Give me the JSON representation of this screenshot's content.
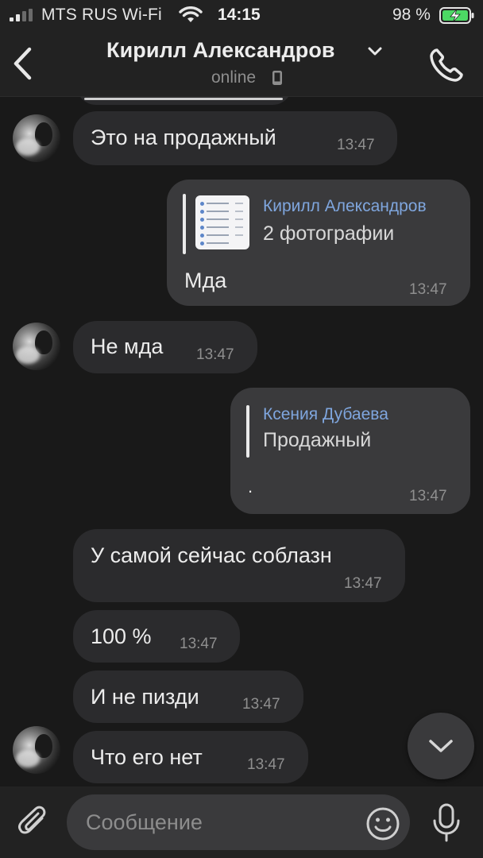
{
  "status_bar": {
    "carrier": "MTS RUS Wi-Fi",
    "time": "14:15",
    "battery_percent": "98 %",
    "icons": [
      "signal-icon",
      "wifi-icon",
      "battery-charging-icon"
    ]
  },
  "header": {
    "title": "Кирилл Александров",
    "status": "online",
    "icons": [
      "back-icon",
      "chevron-down-icon",
      "phone-device-icon",
      "call-icon"
    ]
  },
  "messages": [
    {
      "id": "m1",
      "direction": "in",
      "text": "Это на продажный",
      "time": "13:47",
      "avatar": true
    },
    {
      "id": "m2",
      "direction": "out",
      "reply_to": {
        "name": "Кирилл Александров",
        "text": "2 фотографии",
        "thumbnail": true
      },
      "text": "Мда",
      "time": "13:47"
    },
    {
      "id": "m3",
      "direction": "in",
      "text": "Не мда",
      "time": "13:47",
      "avatar": true
    },
    {
      "id": "m4",
      "direction": "out",
      "reply_to": {
        "name": "Ксения Дубаева",
        "text": "Продажный"
      },
      "text": ".",
      "time": "13:47"
    },
    {
      "id": "m5",
      "direction": "in",
      "text": "У самой сейчас соблазн",
      "time": "13:47",
      "avatar": false
    },
    {
      "id": "m6",
      "direction": "in",
      "text": "100 %",
      "time": "13:47",
      "avatar": false
    },
    {
      "id": "m7",
      "direction": "in",
      "text": "И не пизди",
      "time": "13:47",
      "avatar": false
    },
    {
      "id": "m8",
      "direction": "in",
      "text": "Что его нет",
      "time": "13:47",
      "avatar": true
    }
  ],
  "composer": {
    "placeholder": "Сообщение",
    "value": "",
    "icons": [
      "paperclip-icon",
      "emoji-icon",
      "microphone-icon"
    ]
  },
  "colors": {
    "background": "#191919",
    "bar": "#222222",
    "incoming_bubble": "#2b2b2d",
    "outgoing_bubble": "#3a3a3c",
    "reply_name": "#7fa6de",
    "battery_green": "#4cd964"
  }
}
